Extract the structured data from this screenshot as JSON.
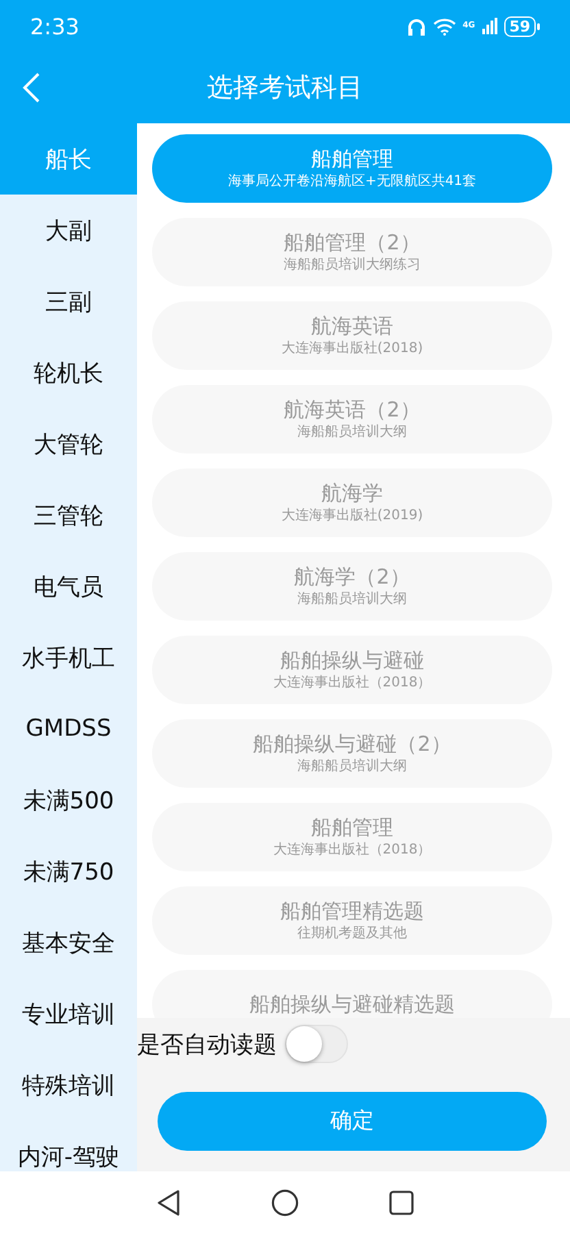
{
  "status_bar": {
    "time": "2:33",
    "battery": "59",
    "network": "4G"
  },
  "header": {
    "title": "选择考试科目"
  },
  "sidebar": {
    "items": [
      {
        "label": "船长",
        "selected": true
      },
      {
        "label": "大副",
        "selected": false
      },
      {
        "label": "三副",
        "selected": false
      },
      {
        "label": "轮机长",
        "selected": false
      },
      {
        "label": "大管轮",
        "selected": false
      },
      {
        "label": "三管轮",
        "selected": false
      },
      {
        "label": "电气员",
        "selected": false
      },
      {
        "label": "水手机工",
        "selected": false
      },
      {
        "label": "GMDSS",
        "selected": false
      },
      {
        "label": "未满500",
        "selected": false
      },
      {
        "label": "未满750",
        "selected": false
      },
      {
        "label": "基本安全",
        "selected": false
      },
      {
        "label": "专业培训",
        "selected": false
      },
      {
        "label": "特殊培训",
        "selected": false
      },
      {
        "label": "内河-驾驶",
        "selected": false
      }
    ]
  },
  "subjects": [
    {
      "title": "船舶管理",
      "subtitle": "海事局公开卷沿海航区+无限航区共41套",
      "selected": true
    },
    {
      "title": "船舶管理（2）",
      "subtitle": "海船船员培训大纲练习",
      "selected": false
    },
    {
      "title": "航海英语",
      "subtitle": "大连海事出版社(2018)",
      "selected": false
    },
    {
      "title": "航海英语（2）",
      "subtitle": "海船船员培训大纲",
      "selected": false
    },
    {
      "title": "航海学",
      "subtitle": "大连海事出版社(2019)",
      "selected": false
    },
    {
      "title": "航海学（2）",
      "subtitle": "海船船员培训大纲",
      "selected": false
    },
    {
      "title": "船舶操纵与避碰",
      "subtitle": "大连海事出版社（2018）",
      "selected": false
    },
    {
      "title": "船舶操纵与避碰（2）",
      "subtitle": "海船船员培训大纲",
      "selected": false
    },
    {
      "title": "船舶管理",
      "subtitle": "大连海事出版社（2018）",
      "selected": false
    },
    {
      "title": "船舶管理精选题",
      "subtitle": "往期机考题及其他",
      "selected": false
    },
    {
      "title": "船舶操纵与避碰精选题",
      "selected": false
    }
  ],
  "auto_read": {
    "label": "是否自动读题",
    "on": false
  },
  "confirm_button": "确定"
}
